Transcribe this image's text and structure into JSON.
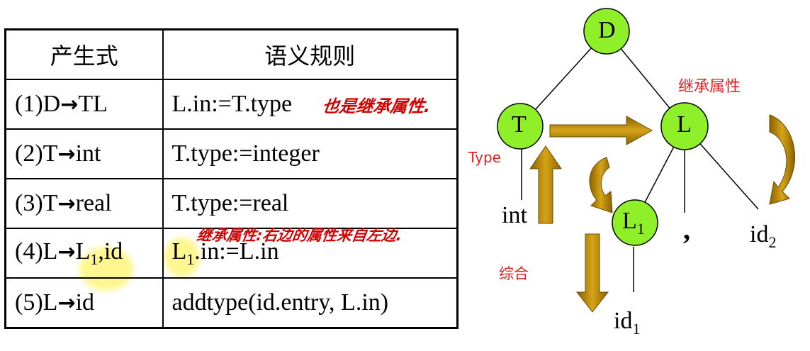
{
  "table": {
    "header": {
      "production": "产生式",
      "rule": "语义规则"
    },
    "rows": [
      {
        "num": "(1)",
        "lhs": "D",
        "rhs": "TL",
        "rule": "L.in:=T.type"
      },
      {
        "num": "(2)",
        "lhs": "T",
        "rhs": "int",
        "rule": "T.type:=integer"
      },
      {
        "num": "(3)",
        "lhs": "T",
        "rhs": "real",
        "rule": "T.type:=real"
      },
      {
        "num": "(4)",
        "lhs": "L",
        "rhs_main": "L",
        "rhs_sub": "1",
        "rhs_tail": ",id",
        "rule_main": "L",
        "rule_sub": "1",
        "rule_tail": ".in:=L.in"
      },
      {
        "num": "(5)",
        "lhs": "L",
        "rhs": "id",
        "rule": "addtype(id.entry, L.in)"
      }
    ],
    "arrow_symbol": "→"
  },
  "handwritten_notes": {
    "note1": "也是继承属性.",
    "note2": "继承属性:右边的属性来自左边."
  },
  "tree": {
    "nodes": {
      "d": "D",
      "t": "T",
      "l": "L",
      "l1_main": "L",
      "l1_sub": "1"
    },
    "leaves": {
      "int": "int",
      "comma": ",",
      "id1_main": "id",
      "id1_sub": "1",
      "id2_main": "id",
      "id2_sub": "2"
    },
    "labels": {
      "inherited": "继承属性",
      "type": "Type",
      "synthesized": "综合"
    },
    "colors": {
      "node_fill": "#8ff02a",
      "arrow_fill": "#c8960c",
      "label_red": "#e02020"
    }
  }
}
